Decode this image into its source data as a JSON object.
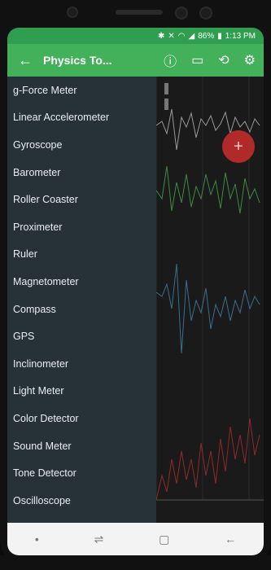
{
  "statusbar": {
    "battery": "86%",
    "time": "1:13 PM",
    "icons": [
      "bluetooth-icon",
      "mute-icon",
      "wifi-icon",
      "signal-icon",
      "battery-icon"
    ]
  },
  "appbar": {
    "title": "Physics To...",
    "back_icon": "arrow-left-icon",
    "actions": [
      "info-icon",
      "folder-icon",
      "rotate-icon",
      "gear-icon"
    ]
  },
  "drawer": {
    "items": [
      "g-Force Meter",
      "Linear Accelerometer",
      "Gyroscope",
      "Barometer",
      "Roller Coaster",
      "Proximeter",
      "Ruler",
      "Magnetometer",
      "Compass",
      "GPS",
      "Inclinometer",
      "Light Meter",
      "Color Detector",
      "Sound Meter",
      "Tone Detector",
      "Oscilloscope"
    ]
  },
  "graph": {
    "axis_ticks": [
      "5",
      "10"
    ],
    "series_colors": [
      "#9a9a9a",
      "#3d8a44",
      "#3a6f8f",
      "#8f2a2a"
    ]
  },
  "fab": {
    "label": "+"
  },
  "navbar": {
    "icons": [
      "dot-icon",
      "recent-apps-icon",
      "home-icon",
      "back-icon"
    ]
  }
}
